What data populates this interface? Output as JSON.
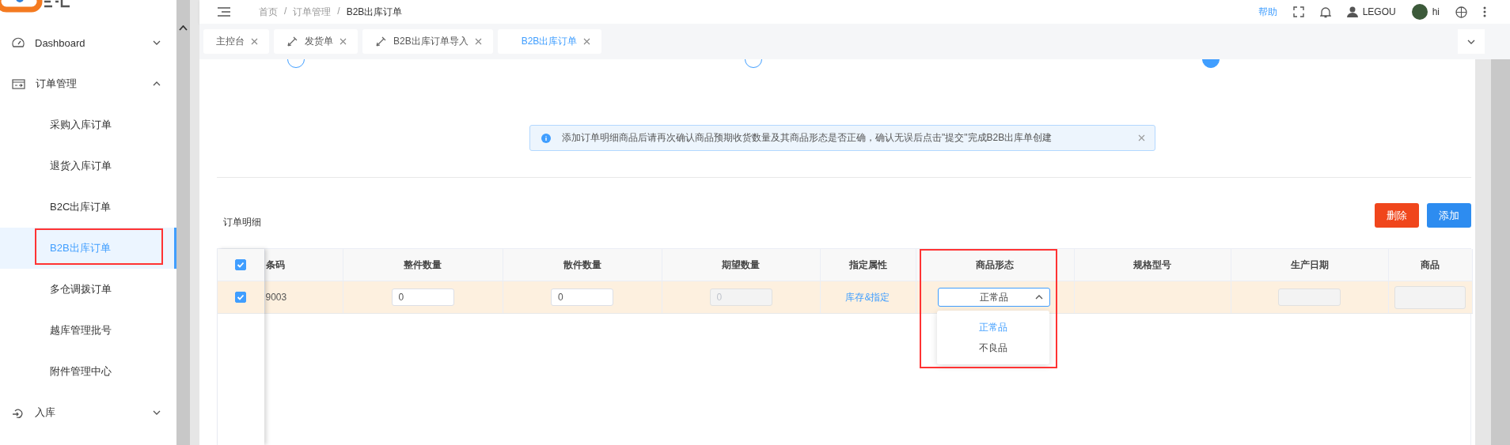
{
  "header": {
    "breadcrumb": [
      "首页",
      "订单管理",
      "B2B出库订单"
    ],
    "breadcrumb_separator": "/",
    "help": "帮助",
    "user": "LEGOU",
    "greeting": "hi"
  },
  "sidebar": {
    "items": [
      {
        "label": "Dashboard",
        "kind": "dashboard",
        "selected": false,
        "expanded": false
      },
      {
        "label": "订单管理",
        "kind": "order",
        "selected": false,
        "expanded": true,
        "children": [
          {
            "label": "采购入库订单",
            "selected": false,
            "highlighted": false
          },
          {
            "label": "退货入库订单",
            "selected": false,
            "highlighted": false
          },
          {
            "label": "B2C出库订单",
            "selected": false,
            "highlighted": false
          },
          {
            "label": "B2B出库订单",
            "selected": true,
            "highlighted": true
          },
          {
            "label": "多仓调拨订单",
            "selected": false,
            "highlighted": false
          },
          {
            "label": "越库管理批号",
            "selected": false,
            "highlighted": false
          },
          {
            "label": "附件管理中心",
            "selected": false,
            "highlighted": false
          }
        ]
      },
      {
        "label": "入库",
        "kind": "inbound",
        "selected": false,
        "expanded": false
      }
    ]
  },
  "tabs": [
    {
      "label": "主控台",
      "kind": "plain",
      "selected": false
    },
    {
      "label": "发货单",
      "kind": "icon",
      "selected": false
    },
    {
      "label": "B2B出库订单导入",
      "kind": "icon",
      "selected": false
    },
    {
      "label": "B2B出库订单",
      "kind": "plain",
      "selected": true
    }
  ],
  "steps": [
    {
      "active": false
    },
    {
      "active": false
    },
    {
      "active": true
    }
  ],
  "alert": {
    "text": "添加订单明细商品后请再次确认商品预期收货数量及其商品形态是否正确，确认无误后点击\"提交\"完成B2B出库单创建"
  },
  "section_title": "订单明细",
  "buttons": [
    {
      "label": "删除",
      "kind": "danger"
    },
    {
      "label": "添加",
      "kind": "primary"
    }
  ],
  "table": {
    "all_checked": true,
    "columns": [
      {
        "label": "条码",
        "highlighted": false
      },
      {
        "label": "整件数量",
        "highlighted": false
      },
      {
        "label": "散件数量",
        "highlighted": false
      },
      {
        "label": "期望数量",
        "highlighted": false
      },
      {
        "label": "指定属性",
        "highlighted": false
      },
      {
        "label": "商品形态",
        "highlighted": true
      },
      {
        "label": "规格型号",
        "highlighted": false
      },
      {
        "label": "生产日期",
        "highlighted": false
      },
      {
        "label": "商品",
        "highlighted": false
      }
    ],
    "rows": [
      {
        "checked": true,
        "cells": [
          {
            "kind": "text",
            "text": "9003"
          },
          {
            "kind": "input",
            "value": "0",
            "disabled": false
          },
          {
            "kind": "input",
            "value": "0",
            "disabled": false
          },
          {
            "kind": "input",
            "value": "0",
            "disabled": true
          },
          {
            "kind": "link",
            "text": "库存&指定"
          },
          {
            "kind": "select",
            "value": "正常品",
            "expanded": true,
            "options": [
              {
                "label": "正常品",
                "selected": true
              },
              {
                "label": "不良品",
                "selected": false
              }
            ]
          },
          {
            "kind": "empty"
          },
          {
            "kind": "input",
            "disabled": true
          },
          {
            "kind": "input",
            "disabled": true
          }
        ]
      }
    ]
  }
}
